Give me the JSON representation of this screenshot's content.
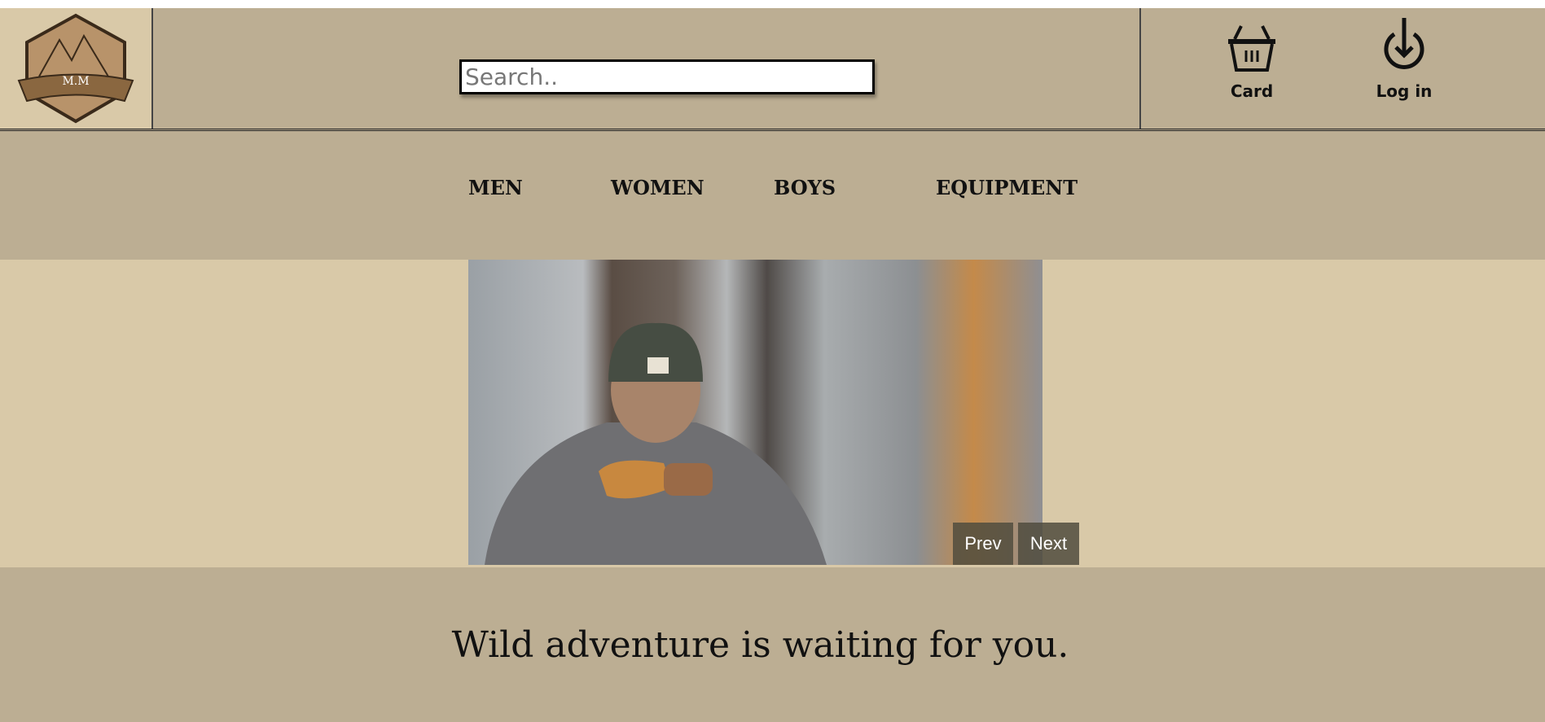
{
  "header": {
    "logo_text": "M.M",
    "search_placeholder": "Search..",
    "cart_label": "Card",
    "login_label": "Log in"
  },
  "nav": {
    "items": [
      "MEN",
      "WOMEN",
      "BOYS",
      "EQUIPMENT"
    ]
  },
  "slider": {
    "prev_label": "Prev",
    "next_label": "Next"
  },
  "footer": {
    "tagline": "Wild adventure is waiting for you."
  }
}
